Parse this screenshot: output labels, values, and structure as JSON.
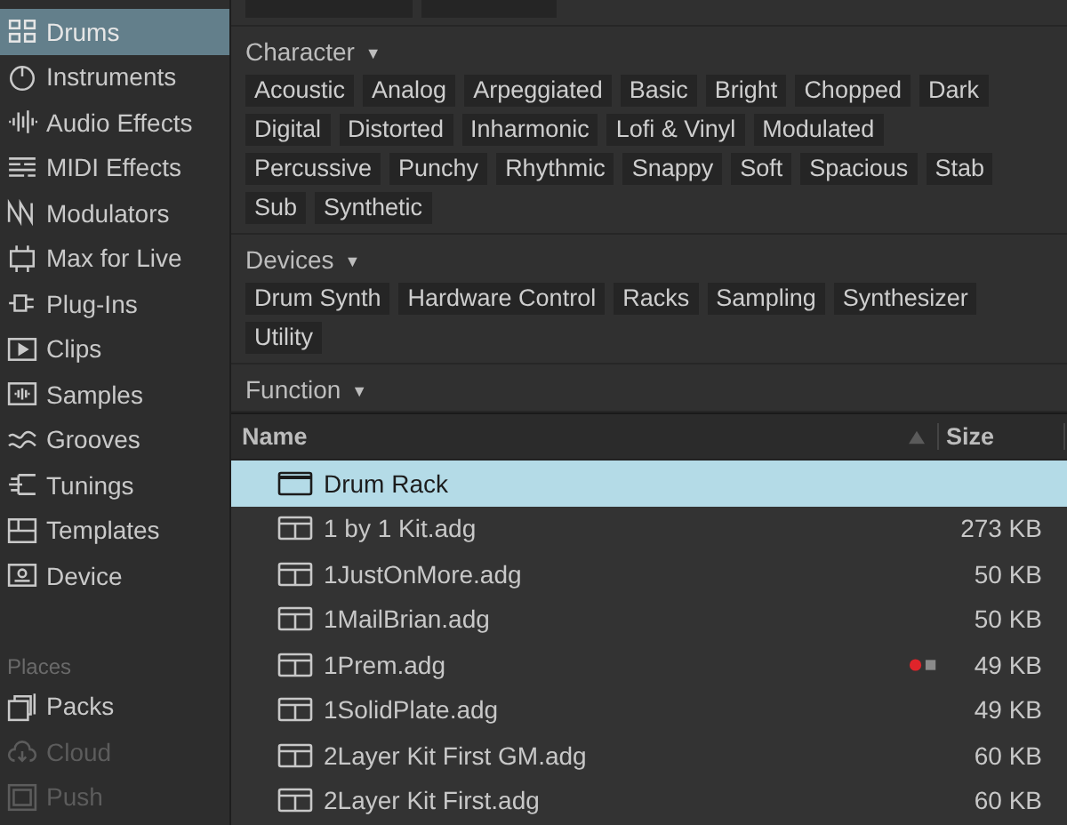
{
  "sidebar": {
    "categories": [
      {
        "label": "Drums",
        "selected": true
      },
      {
        "label": "Instruments",
        "selected": false
      },
      {
        "label": "Audio Effects",
        "selected": false
      },
      {
        "label": "MIDI Effects",
        "selected": false
      },
      {
        "label": "Modulators",
        "selected": false
      },
      {
        "label": "Max for Live",
        "selected": false
      },
      {
        "label": "Plug-Ins",
        "selected": false
      },
      {
        "label": "Clips",
        "selected": false
      },
      {
        "label": "Samples",
        "selected": false
      },
      {
        "label": "Grooves",
        "selected": false
      },
      {
        "label": "Tunings",
        "selected": false
      },
      {
        "label": "Templates",
        "selected": false
      },
      {
        "label": "Device",
        "selected": false
      }
    ],
    "places_label": "Places",
    "places": [
      {
        "label": "Packs",
        "disabled": false
      },
      {
        "label": "Cloud",
        "disabled": true
      },
      {
        "label": "Push",
        "disabled": true
      }
    ]
  },
  "filters": {
    "sections": [
      {
        "title": "Character",
        "arrow": "▼",
        "tags": [
          "Acoustic",
          "Analog",
          "Arpeggiated",
          "Basic",
          "Bright",
          "Chopped",
          "Dark",
          "Digital",
          "Distorted",
          "Inharmonic",
          "Lofi & Vinyl",
          "Modulated",
          "Percussive",
          "Punchy",
          "Rhythmic",
          "Snappy",
          "Soft",
          "Spacious",
          "Stab",
          "Sub",
          "Synthetic"
        ]
      },
      {
        "title": "Devices",
        "arrow": "▼",
        "tags": [
          "Drum Synth",
          "Hardware Control",
          "Racks",
          "Sampling",
          "Synthesizer",
          "Utility"
        ]
      },
      {
        "title": "Function",
        "arrow": "▼"
      }
    ]
  },
  "table": {
    "columns": [
      "Name",
      "Size"
    ],
    "rows": [
      {
        "kind": "device",
        "name": "Drum Rack",
        "size": "",
        "selected": true,
        "marked": false
      },
      {
        "kind": "preset",
        "name": "1 by 1 Kit.adg",
        "size": "273 KB",
        "selected": false,
        "marked": false
      },
      {
        "kind": "preset",
        "name": "1JustOnMore.adg",
        "size": "50 KB",
        "selected": false,
        "marked": false
      },
      {
        "kind": "preset",
        "name": "1MailBrian.adg",
        "size": "50 KB",
        "selected": false,
        "marked": false
      },
      {
        "kind": "preset",
        "name": "1Prem.adg",
        "size": "49 KB",
        "selected": false,
        "marked": true
      },
      {
        "kind": "preset",
        "name": "1SolidPlate.adg",
        "size": "49 KB",
        "selected": false,
        "marked": false
      },
      {
        "kind": "preset",
        "name": "2Layer Kit First GM.adg",
        "size": "60 KB",
        "selected": false,
        "marked": false
      },
      {
        "kind": "preset",
        "name": "2Layer Kit First.adg",
        "size": "60 KB",
        "selected": false,
        "marked": false
      }
    ]
  }
}
